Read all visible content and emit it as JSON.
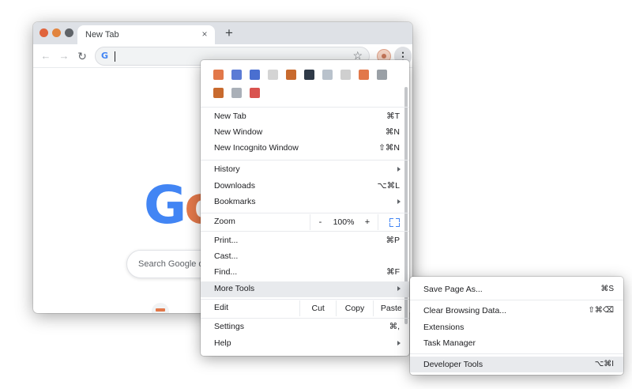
{
  "tab": {
    "title": "New Tab",
    "close_glyph": "×",
    "new_tab_glyph": "+"
  },
  "toolbar": {
    "back_glyph": "←",
    "forward_glyph": "→",
    "reload_glyph": "↻",
    "omnibox_g": "G",
    "bookmark_glyph": "☆",
    "menu_glyph": "⋮"
  },
  "content": {
    "logo_part1": "G",
    "logo_part2": "o",
    "search_placeholder": "Search Google or t"
  },
  "extensions": {
    "row1": [
      {
        "icon": "speedometer-icon",
        "color": "#e2784a"
      },
      {
        "icon": "triangle-icon",
        "color": "#5b7bd5"
      },
      {
        "icon": "shield-icon",
        "color": "#4a6fd0"
      },
      {
        "icon": "checker-icon",
        "color": "#d4d4d4"
      },
      {
        "icon": "book-icon",
        "color": "#c86a2e"
      },
      {
        "icon": "globe-icon",
        "color": "#2f3a48"
      },
      {
        "icon": "ghost-icon",
        "color": "#b9c2cc"
      },
      {
        "icon": "ruler-icon",
        "color": "#cfcfcf"
      },
      {
        "icon": "chart-icon",
        "color": "#e2784a"
      },
      {
        "icon": "laptop-icon",
        "color": "#9aa0a6"
      }
    ],
    "row2": [
      {
        "icon": "notebook-icon",
        "color": "#c86a2e"
      },
      {
        "icon": "frame-icon",
        "color": "#aab0b8"
      },
      {
        "icon": "rocket-icon",
        "color": "#d9534f"
      }
    ]
  },
  "menu": {
    "new_tab": {
      "label": "New Tab",
      "shortcut": "⌘T"
    },
    "new_window": {
      "label": "New Window",
      "shortcut": "⌘N"
    },
    "new_incognito": {
      "label": "New Incognito Window",
      "shortcut": "⇧⌘N"
    },
    "history": {
      "label": "History"
    },
    "downloads": {
      "label": "Downloads",
      "shortcut": "⌥⌘L"
    },
    "bookmarks": {
      "label": "Bookmarks"
    },
    "zoom": {
      "label": "Zoom",
      "minus": "-",
      "value": "100%",
      "plus": "+"
    },
    "print": {
      "label": "Print...",
      "shortcut": "⌘P"
    },
    "cast": {
      "label": "Cast..."
    },
    "find": {
      "label": "Find...",
      "shortcut": "⌘F"
    },
    "more_tools": {
      "label": "More Tools"
    },
    "edit": {
      "label": "Edit",
      "cut": "Cut",
      "copy": "Copy",
      "paste": "Paste"
    },
    "settings": {
      "label": "Settings",
      "shortcut": "⌘,"
    },
    "help": {
      "label": "Help"
    }
  },
  "submenu": {
    "save_page": {
      "label": "Save Page As...",
      "shortcut": "⌘S"
    },
    "clear_data": {
      "label": "Clear Browsing Data...",
      "shortcut": "⇧⌘⌫"
    },
    "extensions": {
      "label": "Extensions"
    },
    "task_manager": {
      "label": "Task Manager"
    },
    "developer_tools": {
      "label": "Developer Tools",
      "shortcut": "⌥⌘I"
    }
  }
}
